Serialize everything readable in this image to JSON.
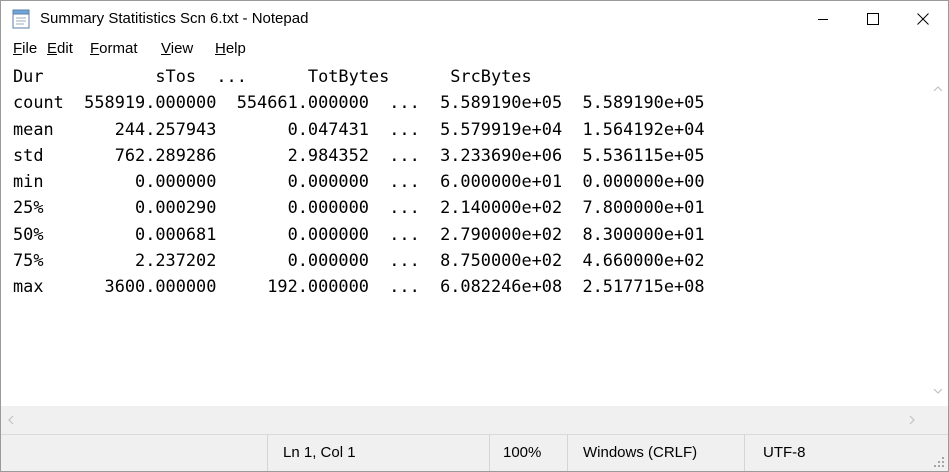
{
  "window": {
    "title": "Summary Statitistics Scn 6.txt - Notepad"
  },
  "menu": [
    {
      "label": "File"
    },
    {
      "label": "Edit"
    },
    {
      "label": "Format"
    },
    {
      "label": "View"
    },
    {
      "label": "Help"
    }
  ],
  "editor": {
    "lines": [
      "Dur           sTos  ...      TotBytes      SrcBytes",
      "count  558919.000000  554661.000000  ...  5.589190e+05  5.589190e+05",
      "mean      244.257943       0.047431  ...  5.579919e+04  1.564192e+04",
      "std       762.289286       2.984352  ...  3.233690e+06  5.536115e+05",
      "min         0.000000       0.000000  ...  6.000000e+01  0.000000e+00",
      "25%         0.000290       0.000000  ...  2.140000e+02  7.800000e+01",
      "50%         0.000681       0.000000  ...  2.790000e+02  8.300000e+01",
      "75%         2.237202       0.000000  ...  8.750000e+02  4.660000e+02",
      "max      3600.000000     192.000000  ...  6.082246e+08  2.517715e+08"
    ]
  },
  "status": {
    "position": "Ln 1, Col 1",
    "zoom": "100%",
    "line_ending": "Windows (CRLF)",
    "encoding": "UTF-8"
  },
  "icons": {
    "app": "notepad-icon",
    "minimize": "minimize-icon",
    "maximize": "maximize-icon",
    "close": "close-icon",
    "scroll_up": "chevron-up-icon",
    "scroll_down": "chevron-down-icon",
    "scroll_left": "chevron-left-icon",
    "scroll_right": "chevron-right-icon",
    "resize": "resize-grip-icon"
  }
}
